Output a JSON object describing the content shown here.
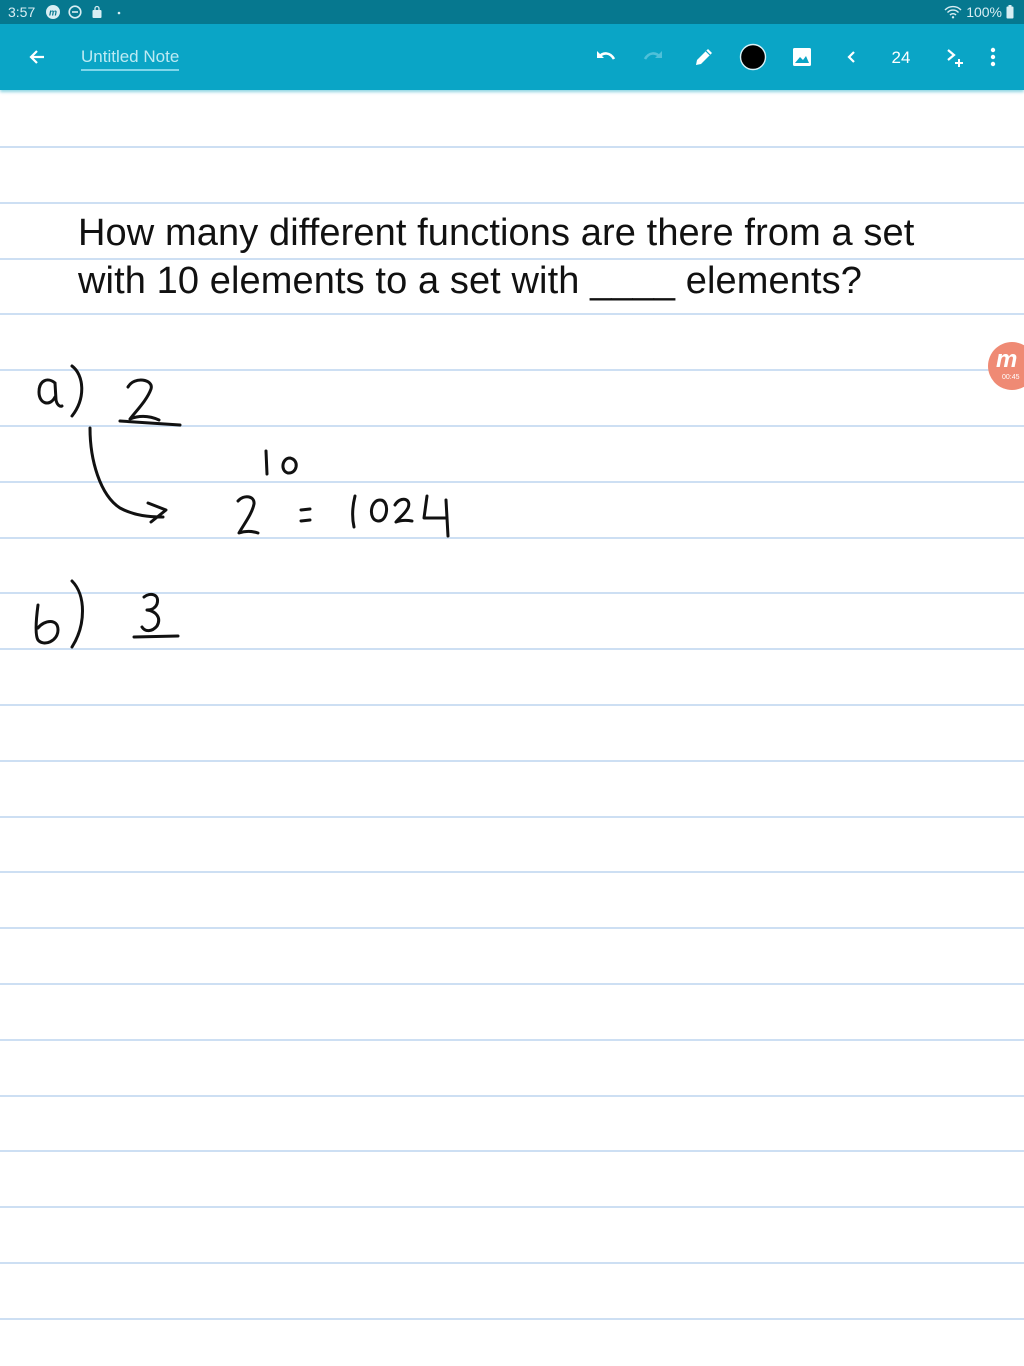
{
  "status_bar": {
    "time": "3:57",
    "left_icons": [
      "app-notification-icon",
      "do-not-disturb-icon",
      "shopping-bag-icon",
      "dot-icon"
    ],
    "battery": "100%",
    "right_icons": [
      "wifi-icon",
      "battery-icon"
    ]
  },
  "toolbar": {
    "back_icon": "arrow-left-icon",
    "title": "Untitled Note",
    "actions": [
      "undo",
      "redo",
      "pen",
      "color",
      "insert-image",
      "previous-page",
      "page-number",
      "next-page-add",
      "more"
    ],
    "pen_color": "#000000",
    "page_number": "24",
    "accent_color": "#0aa5c6"
  },
  "note": {
    "question_line1": "How many different functions are there from a set",
    "question_line2": "with 10 elements to a set with ____ elements?",
    "handwriting": {
      "part_a_label": "a)",
      "part_a_value": "2",
      "part_a_exponent": "10",
      "part_a_base": "2",
      "part_a_equals": "=",
      "part_a_result": "1024",
      "part_b_label": "b)",
      "part_b_value": "3"
    }
  },
  "recorder_badge": {
    "label": "m",
    "time": "00:45",
    "color": "#ef8a74"
  }
}
